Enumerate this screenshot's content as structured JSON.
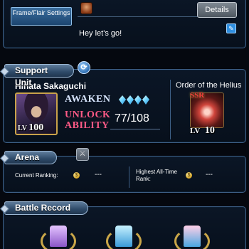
{
  "profile": {
    "frame_button_label": "Frame/Flair Settings",
    "details_button_label": "Details",
    "greeting": "Hey let's go!"
  },
  "support_unit": {
    "header": "Support Unit",
    "unit_name": "Hinata Sakaguchi",
    "unit_level": "100",
    "awaken_label": "AWAKEN",
    "awaken_crystals": 4,
    "unlock_ability_label": "UNLOCK ABILITY",
    "unlock_count": "77/108",
    "gear_title": "Order of the Helius",
    "gear_rarity": "SSR",
    "gear_level": "10",
    "lv_prefix": "LV"
  },
  "arena": {
    "header": "Arena",
    "current_ranking_label": "Current Ranking:",
    "current_ranking_value": "---",
    "highest_rank_label": "Highest All-Time Rank:",
    "highest_rank_value": "---"
  },
  "battle_record": {
    "header": "Battle Record"
  },
  "colors": {
    "accent": "#3d5f86",
    "unlock": "#ff5a86",
    "awaken": "#d8e6ff"
  }
}
